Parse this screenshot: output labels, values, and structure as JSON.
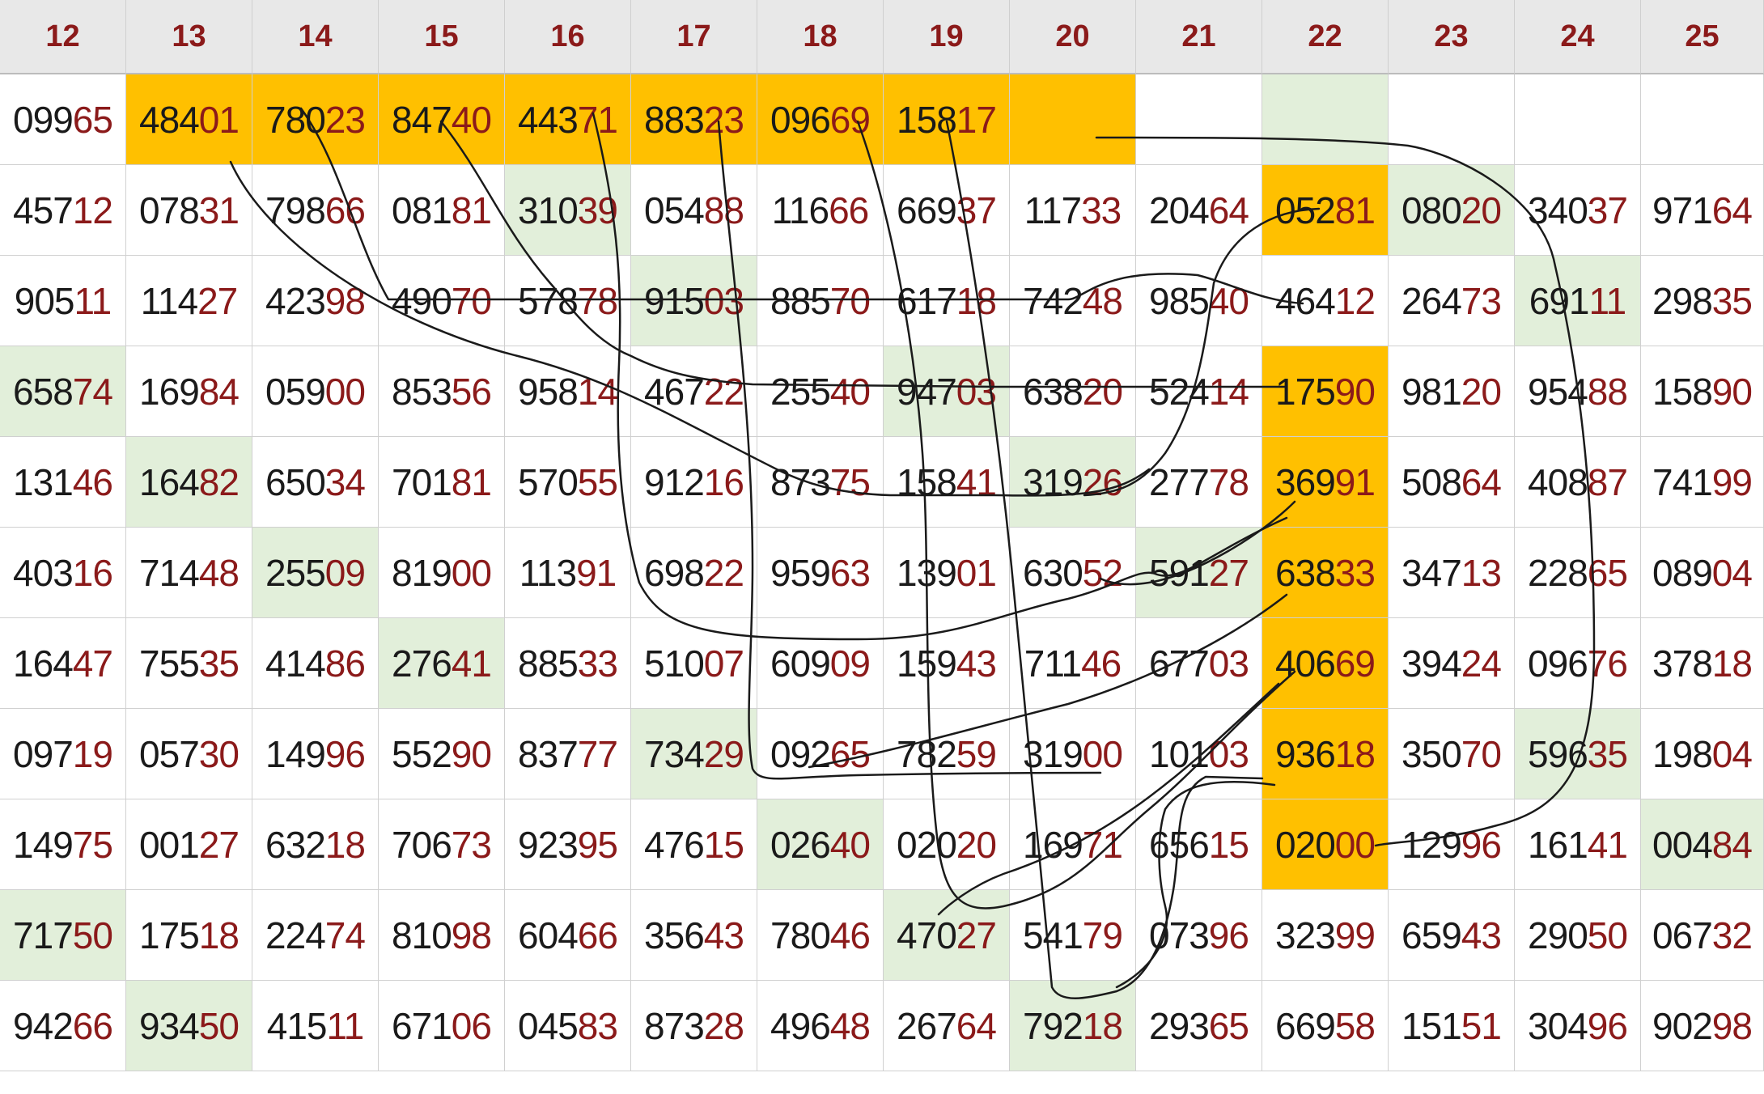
{
  "colors": {
    "orange": "#ffc000",
    "green": "#e2efda",
    "white": "#ffffff",
    "header": "#e8e8e8",
    "digit_dark": "#1a1a1a",
    "digit_red": "#8b1a1a"
  },
  "headers": [
    "12",
    "13",
    "14",
    "15",
    "16",
    "17",
    "18",
    "19",
    "20",
    "21",
    "22",
    "23",
    "24",
    "25"
  ],
  "rows": [
    [
      "09965",
      "48401",
      "78023",
      "84740",
      "44371",
      "88323",
      "09669",
      "15817",
      "",
      "",
      "",
      "",
      "",
      ""
    ],
    [
      "45712",
      "07831",
      "79866",
      "08181",
      "31039",
      "05488",
      "11666",
      "66937",
      "11733",
      "20464",
      "05281",
      "08020",
      "34037",
      "97164"
    ],
    [
      "90511",
      "11427",
      "42398",
      "49070",
      "57878",
      "91503",
      "88570",
      "61718",
      "74248",
      "98540",
      "46412",
      "26473",
      "69111",
      "29835"
    ],
    [
      "65874",
      "16984",
      "05900",
      "85356",
      "95814",
      "46722",
      "25540",
      "94703",
      "63820",
      "52414",
      "17590",
      "98120",
      "95488",
      "15890"
    ],
    [
      "13146",
      "16482",
      "65034",
      "70181",
      "57055",
      "91216",
      "87375",
      "15841",
      "31926",
      "27778",
      "36991",
      "50864",
      "40887",
      "74199"
    ],
    [
      "40316",
      "71448",
      "25509",
      "81900",
      "11391",
      "69822",
      "95963",
      "13901",
      "63052",
      "59127",
      "63833",
      "34713",
      "22865",
      "08904"
    ],
    [
      "16447",
      "75535",
      "41486",
      "27641",
      "88533",
      "51007",
      "60909",
      "15943",
      "71146",
      "67703",
      "40669",
      "39424",
      "09676",
      "37818"
    ],
    [
      "09719",
      "05730",
      "14996",
      "55290",
      "83777",
      "73429",
      "09265",
      "78259",
      "31900",
      "10103",
      "93618",
      "35070",
      "59635",
      "19804"
    ],
    [
      "14975",
      "00127",
      "63218",
      "70673",
      "92395",
      "47615",
      "02640",
      "02020",
      "16971",
      "65615",
      "02000",
      "12996",
      "16141",
      "00484"
    ],
    [
      "71750",
      "17518",
      "22474",
      "81098",
      "60466",
      "35643",
      "78046",
      "47027",
      "54179",
      "07396",
      "32399",
      "65943",
      "29050",
      "06732"
    ],
    [
      "94266",
      "93450",
      "41511",
      "67106",
      "04583",
      "87328",
      "49648",
      "26764",
      "79218",
      "29365",
      "66958",
      "15151",
      "30496",
      "90298"
    ]
  ],
  "highlights": {
    "orange": [
      [
        0,
        1
      ],
      [
        0,
        2
      ],
      [
        0,
        3
      ],
      [
        0,
        4
      ],
      [
        0,
        5
      ],
      [
        0,
        6
      ],
      [
        0,
        7
      ],
      [
        0,
        8
      ],
      [
        1,
        10
      ],
      [
        3,
        10
      ],
      [
        4,
        10
      ],
      [
        5,
        10
      ],
      [
        6,
        10
      ],
      [
        7,
        10
      ],
      [
        8,
        10
      ]
    ],
    "green": [
      [
        0,
        10
      ],
      [
        1,
        4
      ],
      [
        1,
        11
      ],
      [
        2,
        5
      ],
      [
        2,
        12
      ],
      [
        3,
        0
      ],
      [
        3,
        7
      ],
      [
        4,
        1
      ],
      [
        4,
        8
      ],
      [
        5,
        2
      ],
      [
        5,
        9
      ],
      [
        6,
        3
      ],
      [
        7,
        5
      ],
      [
        7,
        12
      ],
      [
        8,
        6
      ],
      [
        8,
        13
      ],
      [
        9,
        0
      ],
      [
        9,
        7
      ],
      [
        10,
        1
      ],
      [
        10,
        8
      ]
    ]
  }
}
